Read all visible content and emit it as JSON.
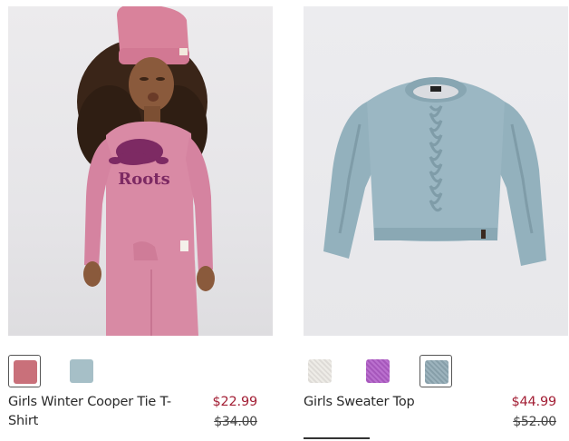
{
  "products": [
    {
      "name": "Girls Winter Cooper Tie T-Shirt",
      "price": "$22.99",
      "original_price": "$34.00",
      "image_text": "Roots",
      "swatches": [
        {
          "color": "#c9707a",
          "selected": true
        },
        {
          "color": "#a6bfc7",
          "selected": false
        }
      ]
    },
    {
      "name": "Girls Sweater Top",
      "price": "$44.99",
      "original_price": "$52.00",
      "swatches": [
        {
          "color": "#ece9e4",
          "selected": false
        },
        {
          "color": "#b05cc7",
          "selected": false
        },
        {
          "color": "#8fa9b4",
          "selected": true
        }
      ]
    }
  ],
  "colors": {
    "sale_price": "#a31f35",
    "text": "#2a2a2a"
  }
}
